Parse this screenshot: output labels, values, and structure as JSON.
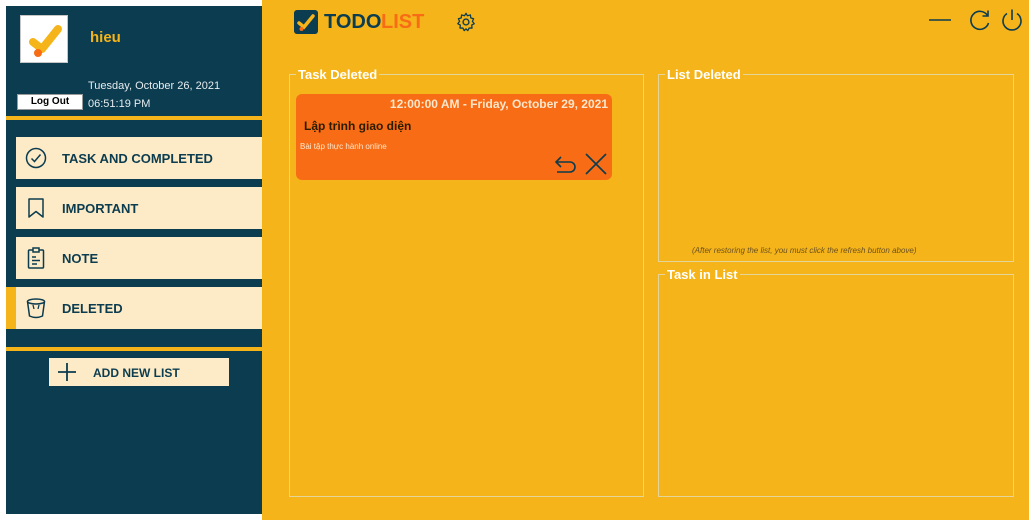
{
  "user": {
    "name": "hieu",
    "date": "Tuesday, October 26, 2021",
    "time": "06:51:19 PM",
    "logout_label": "Log Out"
  },
  "nav": {
    "items": [
      {
        "label": "TASK AND COMPLETED",
        "icon": "check-circle-icon"
      },
      {
        "label": "IMPORTANT",
        "icon": "bookmark-icon"
      },
      {
        "label": "NOTE",
        "icon": "clipboard-icon"
      },
      {
        "label": "DELETED",
        "icon": "trash-icon",
        "active": true
      }
    ],
    "add_label": "ADD NEW LIST"
  },
  "header": {
    "logo_todo": "TODO",
    "logo_list": "LIST"
  },
  "panels": {
    "task_deleted": "Task Deleted",
    "list_deleted": "List Deleted",
    "task_in_list": "Task in List",
    "restore_hint": "(After restoring the list, you must click the refresh button above)"
  },
  "tasks": [
    {
      "datetime": "12:00:00 AM - Friday, October 29, 2021",
      "title": "Lập trình giao diện",
      "description": "Bài tập thực hành online"
    }
  ],
  "colors": {
    "sidebar": "#0c3c4f",
    "accent": "#f5b51a",
    "nav_bg": "#fdeac6",
    "task_card": "#f76c15"
  }
}
